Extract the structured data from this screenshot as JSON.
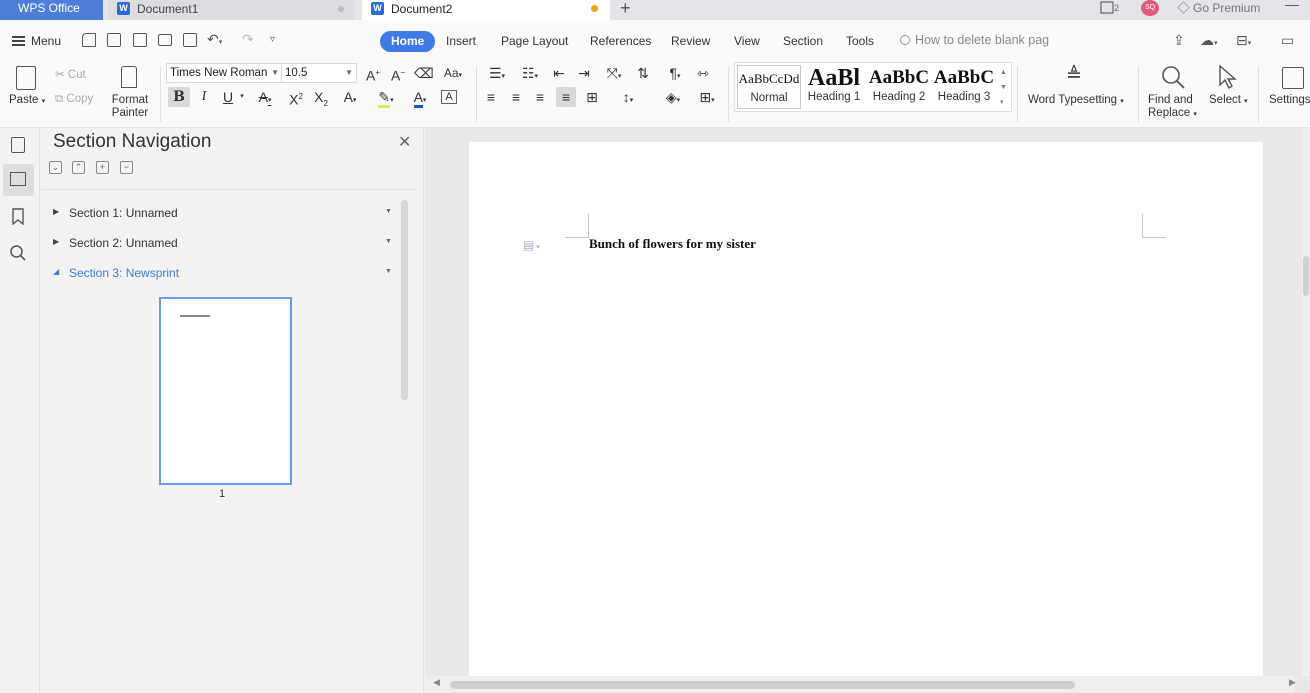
{
  "tabbar": {
    "app_tab": "WPS Office",
    "documents": [
      {
        "label": "Document1",
        "modified": false
      },
      {
        "label": "Document2",
        "modified": true
      }
    ],
    "add_tab": "+",
    "user_initials": "SQ",
    "premium": "Go Premium",
    "minimize": "—"
  },
  "menubar": {
    "menu": "Menu",
    "tabs": [
      "Home",
      "Insert",
      "Page Layout",
      "References",
      "Review",
      "View",
      "Section",
      "Tools"
    ],
    "active_tab": "Home",
    "search_placeholder": "How to delete blank pag"
  },
  "ribbon": {
    "paste": "Paste",
    "cut": "Cut",
    "copy": "Copy",
    "format_painter_1": "Format",
    "format_painter_2": "Painter",
    "font_name": "Times New Roman",
    "font_size": "10.5",
    "bold": "B",
    "italic": "I",
    "underline": "U",
    "styles": [
      {
        "sample": "AaBbCcDd",
        "name": "Normal"
      },
      {
        "sample": "AaBl",
        "name": "Heading 1"
      },
      {
        "sample": "AaBbC",
        "name": "Heading 2"
      },
      {
        "sample": "AaBbC",
        "name": "Heading 3"
      }
    ],
    "word_typesetting": "Word Typesetting",
    "find_replace_1": "Find and",
    "find_replace_2": "Replace",
    "select": "Select",
    "settings": "Settings"
  },
  "nav": {
    "title": "Section Navigation",
    "sections": [
      {
        "label": "Section 1: Unnamed",
        "expanded": false
      },
      {
        "label": "Section 2: Unnamed",
        "expanded": false
      },
      {
        "label": "Section 3: Newsprint",
        "expanded": true
      }
    ],
    "page_number": "1"
  },
  "document": {
    "text": "Bunch of flowers for my sister"
  },
  "colors": {
    "accent": "#3f7ae6",
    "wps_tab": "#4d7fd8",
    "modified_dot": "#f0a516",
    "avatar": "#e05a7a"
  }
}
